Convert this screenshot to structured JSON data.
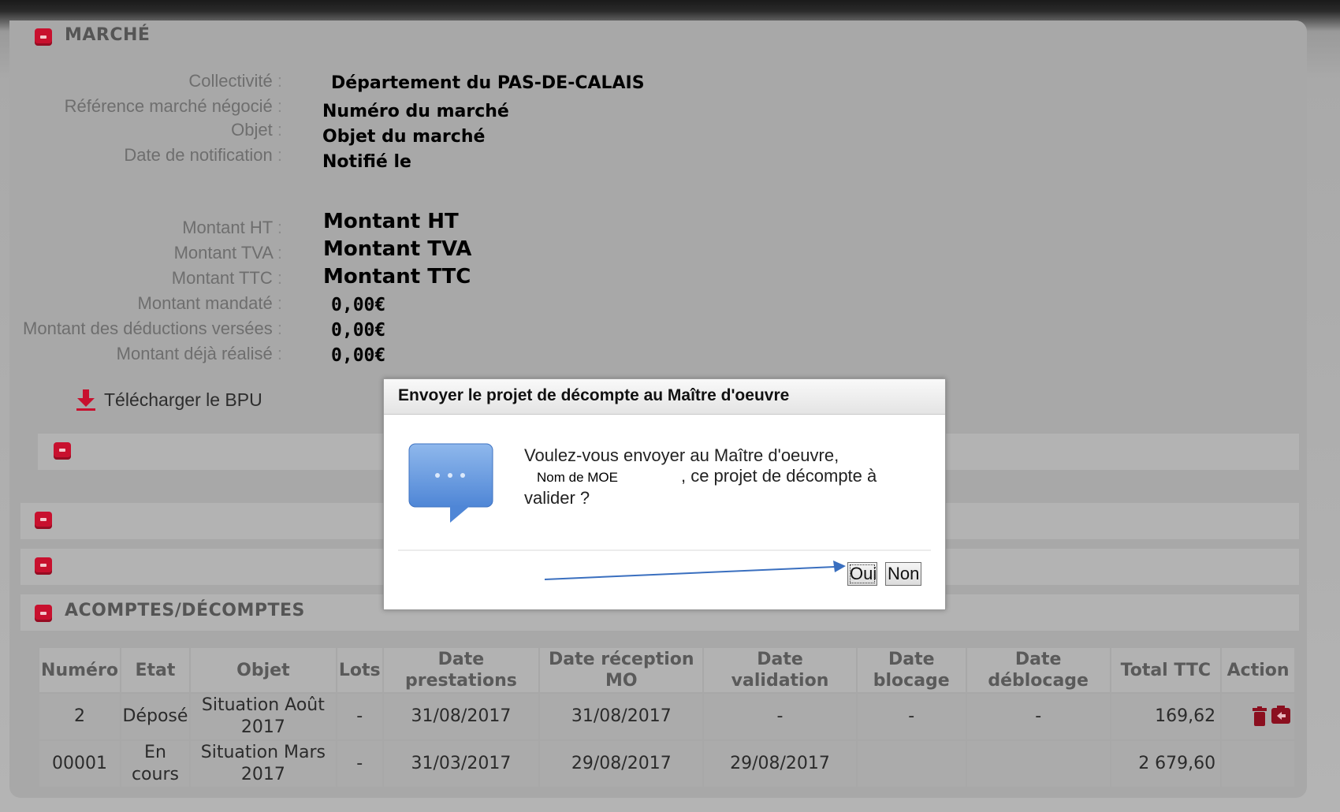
{
  "marche": {
    "title": "MARCHÉ",
    "fields": [
      {
        "label": "Collectivité",
        "value": "Département du PAS-DE-CALAIS"
      },
      {
        "label": "Référence marché négocié",
        "value": "Numéro du marché"
      },
      {
        "label": "Objet",
        "value": "Objet du marché"
      },
      {
        "label": "Date de notification",
        "value": "Notifié le"
      },
      {
        "label": "Montant HT",
        "value": "Montant HT"
      },
      {
        "label": "Montant TVA",
        "value": "Montant TVA"
      },
      {
        "label": "Montant TTC",
        "value": "Montant TTC"
      },
      {
        "label": "Montant mandaté",
        "value": "0,00€"
      },
      {
        "label": "Montant des déductions versées",
        "value": "0,00€"
      },
      {
        "label": "Montant déjà réalisé",
        "value": "0,00€"
      }
    ],
    "download_label": "Télécharger le BPU"
  },
  "acomptes": {
    "title": "ACOMPTES/DÉCOMPTES",
    "headers": [
      "Numéro",
      "Etat",
      "Objet",
      "Lots",
      "Date prestations",
      "Date réception MO",
      "Date validation",
      "Date blocage",
      "Date déblocage",
      "Total TTC",
      "Action"
    ],
    "rows": [
      {
        "numero": "2",
        "etat": "Déposé",
        "objet": "Situation Août 2017",
        "lots": "-",
        "date_prestations": "31/08/2017",
        "date_reception": "31/08/2017",
        "date_validation": "-",
        "date_blocage": "-",
        "date_deblocage": "-",
        "total": "169,62"
      },
      {
        "numero": "00001",
        "etat": "En cours",
        "objet": "Situation Mars 2017",
        "lots": "-",
        "date_prestations": "31/03/2017",
        "date_reception": "29/08/2017",
        "date_validation": "29/08/2017",
        "date_blocage": "",
        "date_deblocage": "",
        "total": "2 679,60"
      }
    ]
  },
  "dialog": {
    "title": "Envoyer le projet de décompte au Maître d'oeuvre",
    "message_line1": "Voulez-vous envoyer au Maître d'oeuvre,",
    "moe_name": "Nom de MOE",
    "message_line2": ", ce projet de décompte à valider ?",
    "yes_label": "Oui",
    "no_label": "Non"
  },
  "colors": {
    "accent": "#c8102e",
    "arrow": "#3a6fbf"
  }
}
